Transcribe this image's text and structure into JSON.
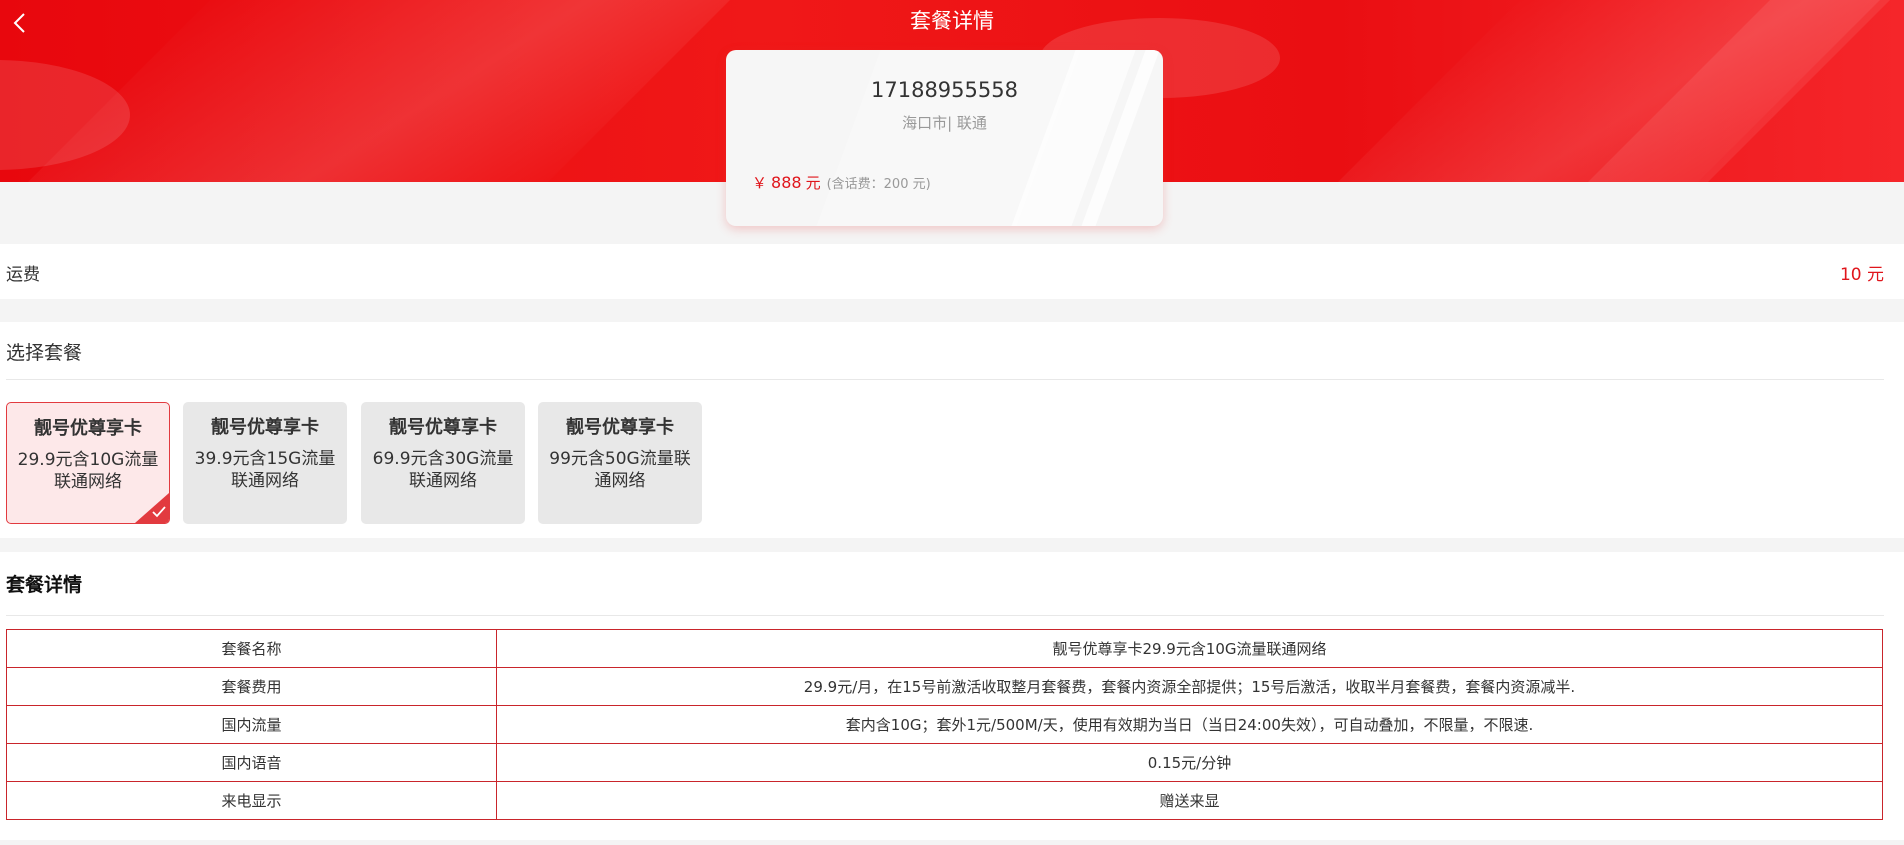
{
  "header": {
    "title": "套餐详情",
    "back_icon": "chevron-left-icon"
  },
  "number_card": {
    "phone": "17188955558",
    "region": "海口市| 联通",
    "price_prefix": "￥",
    "price_amount": "888",
    "price_unit": "元",
    "price_note": "(含话费：200 元)"
  },
  "shipping": {
    "label": "运费",
    "value": "10 元"
  },
  "plans": {
    "heading": "选择套餐",
    "selected_index": 0,
    "items": [
      {
        "name": "靓号优尊享卡",
        "desc": "29.9元含10G流量联通网络"
      },
      {
        "name": "靓号优尊享卡",
        "desc": "39.9元含15G流量联通网络"
      },
      {
        "name": "靓号优尊享卡",
        "desc": "69.9元含30G流量联通网络"
      },
      {
        "name": "靓号优尊享卡",
        "desc": "99元含50G流量联通网络"
      }
    ]
  },
  "details": {
    "heading": "套餐详情",
    "rows": [
      {
        "key": "套餐名称",
        "value": "靓号优尊享卡29.9元含10G流量联通网络"
      },
      {
        "key": "套餐费用",
        "value": "29.9元/月，在15号前激活收取整月套餐费，套餐内资源全部提供；15号后激活，收取半月套餐费，套餐内资源减半."
      },
      {
        "key": "国内流量",
        "value": "套内含10G；套外1元/500M/天，使用有效期为当日（当日24:00失效），可自动叠加，不限量，不限速."
      },
      {
        "key": "国内语音",
        "value": "0.15元/分钟"
      },
      {
        "key": "来电显示",
        "value": "赠送来显"
      }
    ]
  },
  "colors": {
    "brand_red": "#e8070d",
    "accent_red": "#e0151b",
    "table_border": "#c9252b"
  }
}
